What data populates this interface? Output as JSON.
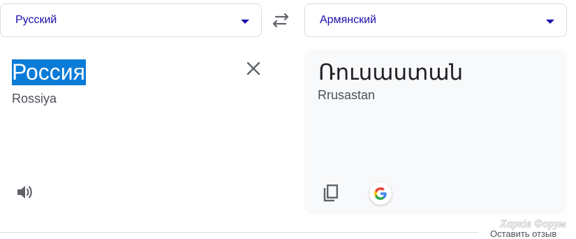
{
  "source_language": {
    "label": "Русский"
  },
  "target_language": {
    "label": "Армянский"
  },
  "source": {
    "text": "Россия",
    "transliteration": "Rossiya",
    "clear_icon": "close-icon",
    "listen_icon": "speaker-icon"
  },
  "translation": {
    "text": "Ռուսաստան",
    "transliteration": "Rrusastan",
    "copy_icon": "copy-icon",
    "google_icon": "google-logo-icon"
  },
  "swap_icon": "swap-arrows-icon",
  "footer": {
    "feedback_label": "Оставить отзыв",
    "watermark": "Харків Форум"
  },
  "colors": {
    "accent_link": "#1a0dab",
    "selection": "#0a7bd7",
    "panel_bg": "#f8f9fa",
    "border": "#dadce0"
  }
}
